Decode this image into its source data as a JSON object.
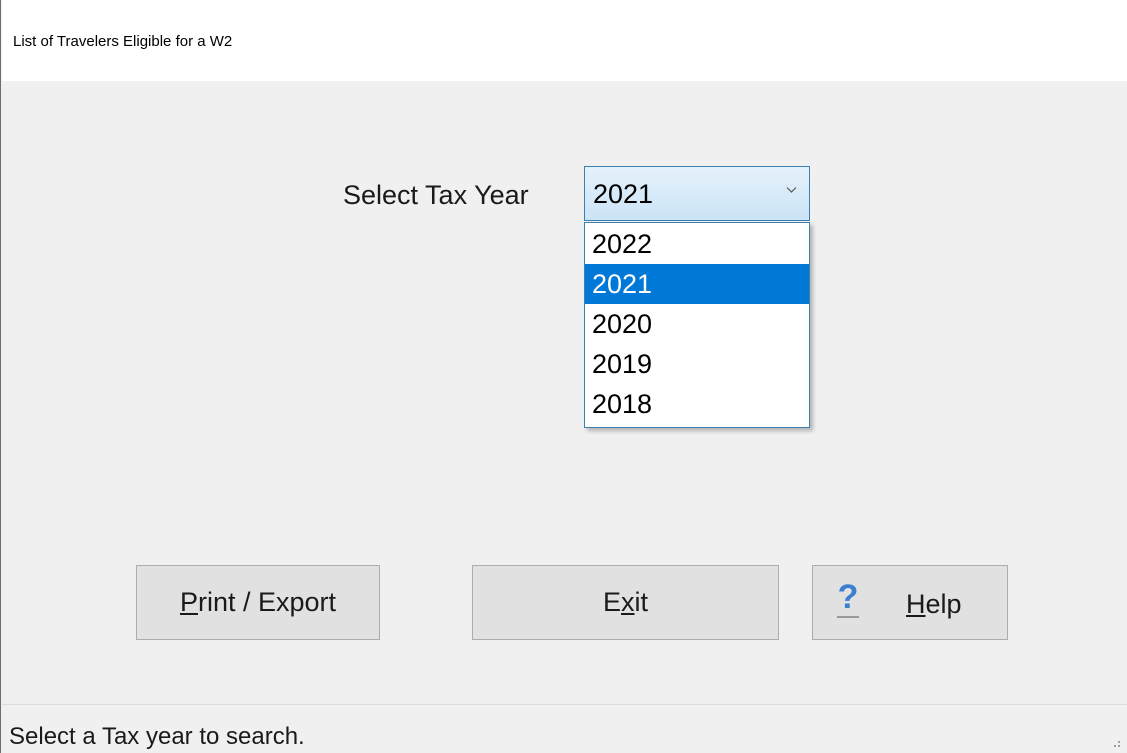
{
  "window": {
    "title": "List of Travelers Eligible for a W2"
  },
  "tax_year": {
    "label": "Select Tax Year",
    "selected_value": "2021",
    "options": [
      "2022",
      "2021",
      "2020",
      "2019",
      "2018"
    ],
    "highlighted_option": "2021"
  },
  "buttons": {
    "print_export": {
      "pre": "",
      "accel": "P",
      "post": "rint / Export"
    },
    "exit": {
      "pre": "E",
      "accel": "x",
      "post": "it"
    },
    "help": {
      "pre": "",
      "accel": "H",
      "post": "elp",
      "icon": "question-mark-icon"
    }
  },
  "status": {
    "text": "Select a Tax year to search."
  },
  "colors": {
    "selection": "#0078d7",
    "combo_border": "#3c7fb1",
    "help_icon": "#3c7fd0"
  }
}
